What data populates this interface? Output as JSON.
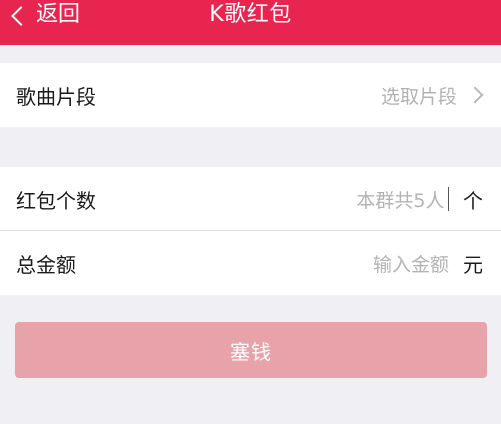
{
  "header": {
    "back_label": "返回",
    "title": "K歌红包",
    "background": "#e8254f"
  },
  "song_section": {
    "label": "歌曲片段",
    "value": "选取片段",
    "icon": "chevron-right-icon"
  },
  "packet_section": {
    "count_label": "红包个数",
    "count_placeholder": "本群共5人",
    "count_unit": "个",
    "amount_label": "总金额",
    "amount_placeholder": "输入金额",
    "amount_unit": "元"
  },
  "submit": {
    "label": "塞钱",
    "color": "#e8a3aa"
  }
}
